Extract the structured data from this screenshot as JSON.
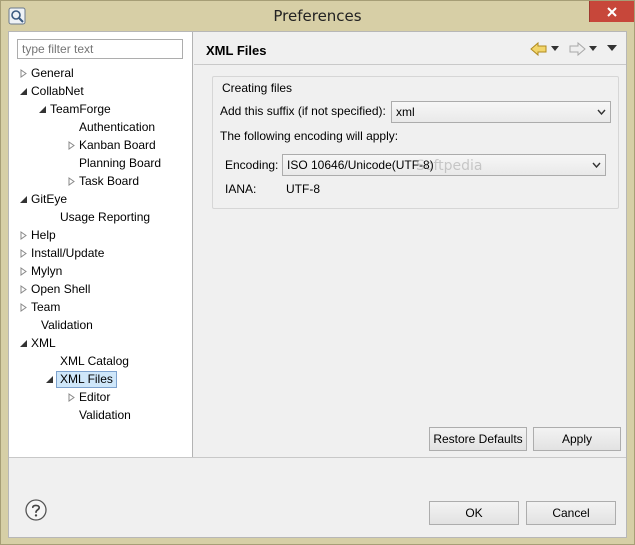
{
  "window": {
    "title": "Preferences"
  },
  "filter": {
    "placeholder": "type filter text"
  },
  "tree": {
    "general": "General",
    "collabnet": "CollabNet",
    "teamforge": "TeamForge",
    "authentication": "Authentication",
    "kanban_board": "Kanban Board",
    "planning_board": "Planning Board",
    "task_board": "Task Board",
    "giteye": "GitEye",
    "usage_reporting": "Usage Reporting",
    "help": "Help",
    "install_update": "Install/Update",
    "mylyn": "Mylyn",
    "open_shell": "Open Shell",
    "team": "Team",
    "validation": "Validation",
    "xml": "XML",
    "xml_catalog": "XML Catalog",
    "xml_files": "XML Files",
    "editor": "Editor",
    "xml_validation": "Validation"
  },
  "page": {
    "title": "XML Files",
    "group_label": "Creating files",
    "suffix_label": "Add this suffix (if not specified):",
    "suffix_value": "xml",
    "encoding_note": "The following encoding will apply:",
    "encoding_label": "Encoding:",
    "encoding_value": "ISO 10646/Unicode(UTF-8)",
    "iana_label": "IANA:",
    "iana_value": "UTF-8",
    "watermark": "Softpedia"
  },
  "buttons": {
    "restore_defaults": "Restore Defaults",
    "apply": "Apply",
    "ok": "OK",
    "cancel": "Cancel"
  },
  "colors": {
    "title_bar": "#d7cfa6",
    "close_button": "#c7473a",
    "selection": "#cfe7fa"
  }
}
